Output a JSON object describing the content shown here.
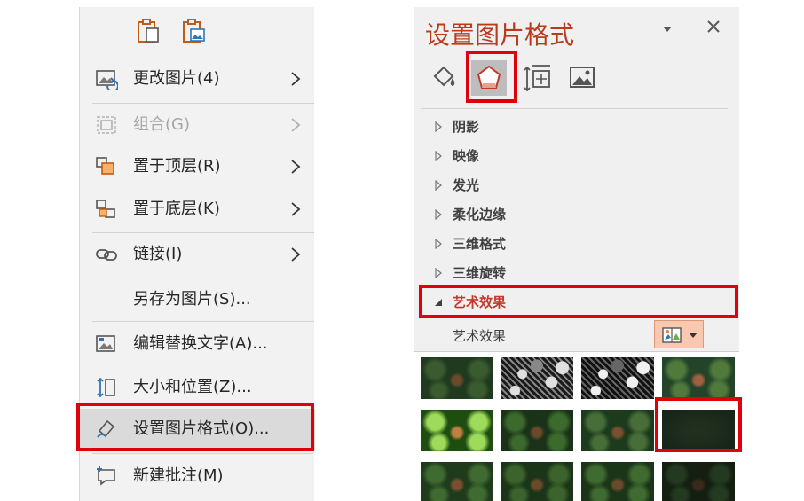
{
  "context_menu": {
    "paste_options": [
      {
        "icon": "paste-keep-formatting-icon"
      },
      {
        "icon": "paste-picture-icon"
      }
    ],
    "items": [
      {
        "label": "更改图片(4)",
        "icon": "change-picture-icon",
        "submenu": true,
        "disabled": false
      },
      {
        "label": "组合(G)",
        "icon": "group-icon",
        "submenu": true,
        "disabled": true
      },
      {
        "label": "置于顶层(R)",
        "icon": "bring-to-front-icon",
        "submenu": true,
        "disabled": false
      },
      {
        "label": "置于底层(K)",
        "icon": "send-to-back-icon",
        "submenu": true,
        "disabled": false
      },
      {
        "label": "链接(I)",
        "icon": "link-icon",
        "submenu": true,
        "disabled": false
      },
      {
        "label": "另存为图片(S)...",
        "icon": "",
        "submenu": false,
        "disabled": false
      },
      {
        "label": "编辑替换文字(A)...",
        "icon": "alt-text-icon",
        "submenu": false,
        "disabled": false
      },
      {
        "label": "大小和位置(Z)...",
        "icon": "size-position-icon",
        "submenu": false,
        "disabled": false
      },
      {
        "label": "设置图片格式(O)...",
        "icon": "format-picture-icon",
        "submenu": false,
        "disabled": false,
        "highlighted": true
      },
      {
        "label": "新建批注(M)",
        "icon": "new-comment-icon",
        "submenu": false,
        "disabled": false
      }
    ]
  },
  "format_pane": {
    "title": "设置图片格式",
    "tabs": [
      {
        "name": "fill-line",
        "icon": "paint-bucket-icon",
        "active": false
      },
      {
        "name": "effects",
        "icon": "pentagon-effects-icon",
        "active": true
      },
      {
        "name": "size-properties",
        "icon": "size-properties-icon",
        "active": false
      },
      {
        "name": "picture",
        "icon": "picture-icon",
        "active": false
      }
    ],
    "sections": [
      {
        "label": "阴影",
        "expanded": false
      },
      {
        "label": "映像",
        "expanded": false
      },
      {
        "label": "发光",
        "expanded": false
      },
      {
        "label": "柔化边缘",
        "expanded": false
      },
      {
        "label": "三维格式",
        "expanded": false
      },
      {
        "label": "三维旋转",
        "expanded": false
      },
      {
        "label": "艺术效果",
        "expanded": true
      }
    ],
    "artistic_effects": {
      "label": "艺术效果",
      "gallery_rows": 3,
      "gallery_cols": 4,
      "selected_index": 7
    }
  },
  "colors": {
    "highlight_border": "#e0000b",
    "title_color": "#b83b1d",
    "menu_bg": "#f2f2f2",
    "pane_bg": "#f0f0f0"
  }
}
